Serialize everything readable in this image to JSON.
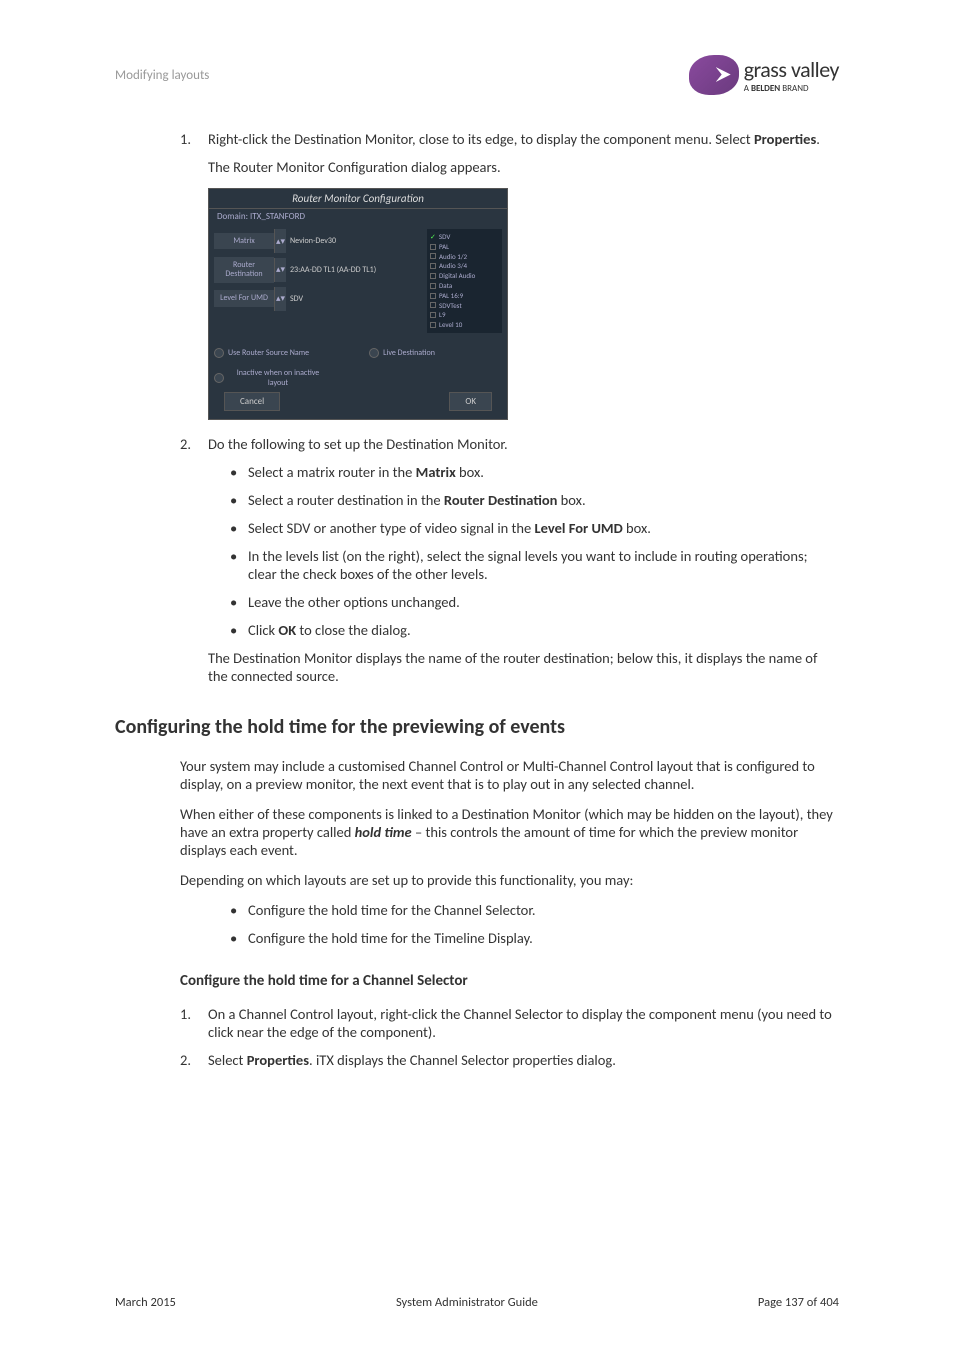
{
  "header": {
    "section": "Modifying layouts",
    "logo_name": "grass valley",
    "logo_tagline_prefix": "A ",
    "logo_tagline_bold": "BELDEN",
    "logo_tagline_suffix": " BRAND"
  },
  "step1": {
    "number": "1.",
    "text_before": "Right-click the Destination Monitor, close to its edge, to display the component menu. Select ",
    "bold": "Properties",
    "text_after": ".",
    "followup": "The Router Monitor Configuration dialog appears."
  },
  "dialog": {
    "title": "Router Monitor Configuration",
    "subtitle": "Domain: ITX_STANFORD",
    "label_matrix": "Matrix",
    "value_matrix": "Nevion-Dev30",
    "label_router": "Router Destination",
    "value_router": "23:AA-DD TL1 (AA-DD TL1)",
    "label_level": "Level For UMD",
    "value_level": "SDV",
    "levels": [
      "SDV",
      "PAL",
      "Audio 1/2",
      "Audio 3/4",
      "Digital Audio",
      "Data",
      "PAL 16:9",
      "SDVTest",
      "L9",
      "Level 10"
    ],
    "option1": "Use Router Source Name",
    "option2": "Live Destination",
    "option3": "Inactive when on inactive layout",
    "btn_cancel": "Cancel",
    "btn_ok": "OK"
  },
  "step2": {
    "number": "2.",
    "intro": "Do the following to set up the Destination Monitor.",
    "bullets": [
      {
        "pre": "Select a matrix router in the ",
        "bold": "Matrix",
        "post": " box."
      },
      {
        "pre": "Select a router destination in the ",
        "bold": "Router Destination",
        "post": " box."
      },
      {
        "pre": "Select SDV or another type of video signal in the ",
        "bold": "Level For UMD",
        "post": " box."
      },
      {
        "pre": "In the levels list (on the right), select the signal levels you want to include in routing operations; clear the check boxes of the other levels.",
        "bold": "",
        "post": ""
      },
      {
        "pre": "Leave the other options unchanged.",
        "bold": "",
        "post": ""
      },
      {
        "pre": "Click ",
        "bold": "OK",
        "post": " to close the dialog."
      }
    ],
    "followup": "The Destination Monitor displays the name of the router destination; below this, it displays the name of the connected source."
  },
  "heading2": "Configuring the hold time for the previewing of events",
  "para1": "Your system may include a customised Channel Control or Multi-Channel Control layout that is configured to display, on a preview monitor, the next event that is to play out in any selected channel.",
  "para2_pre": "When either of these components is linked to a Destination Monitor (which may be hidden on the layout), they have an extra property called ",
  "para2_em": "hold time",
  "para2_post": " – this controls the amount of time for which the preview monitor displays each event.",
  "para3": "Depending on which layouts are set up to provide this functionality, you may:",
  "bullets2": [
    "Configure the hold time for the Channel Selector.",
    "Configure the hold time for the Timeline Display."
  ],
  "heading3": "Configure the hold time for a Channel Selector",
  "step_cs1": {
    "number": "1.",
    "text": "On a Channel Control layout, right-click the Channel Selector to display the component menu (you need to click near the edge of the component)."
  },
  "step_cs2": {
    "number": "2.",
    "pre": "Select ",
    "bold": "Properties",
    "post": ". iTX displays the Channel Selector properties dialog."
  },
  "footer": {
    "left": "March 2015",
    "center": "System Administrator Guide",
    "right": "Page 137 of 404"
  }
}
